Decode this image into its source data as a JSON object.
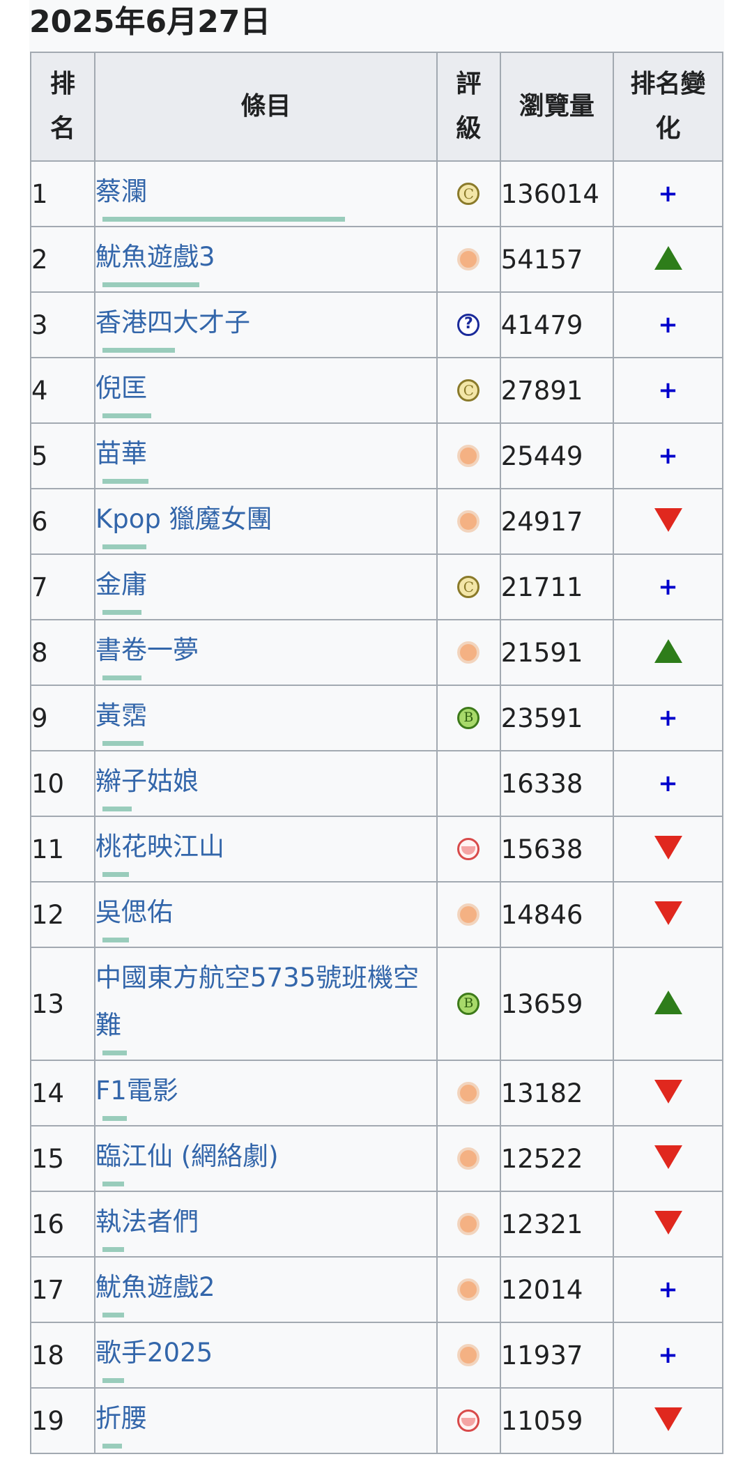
{
  "date": "2025年6月27日",
  "headers": {
    "rank": "排\n名",
    "title": "條目",
    "rating": "評\n級",
    "views": "瀏覽量",
    "change": "排名變\n化"
  },
  "rows": [
    {
      "rank": "1",
      "title": "蔡瀾",
      "rating": "C",
      "views": "136014",
      "change": "new",
      "bar": 1.0
    },
    {
      "rank": "2",
      "title": "魷魚遊戲3",
      "rating": "start",
      "views": "54157",
      "change": "up",
      "bar": 0.4
    },
    {
      "rank": "3",
      "title": "香港四大才子",
      "rating": "unassessed",
      "views": "41479",
      "change": "new",
      "bar": 0.3
    },
    {
      "rank": "4",
      "title": "倪匡",
      "rating": "C",
      "views": "27891",
      "change": "new",
      "bar": 0.2
    },
    {
      "rank": "5",
      "title": "苗華",
      "rating": "start",
      "views": "25449",
      "change": "new",
      "bar": 0.19
    },
    {
      "rank": "6",
      "title": "Kpop 獵魔女團",
      "rating": "start",
      "views": "24917",
      "change": "down",
      "bar": 0.18
    },
    {
      "rank": "7",
      "title": "金庸",
      "rating": "C",
      "views": "21711",
      "change": "new",
      "bar": 0.16
    },
    {
      "rank": "8",
      "title": "書卷一夢",
      "rating": "start",
      "views": "21591",
      "change": "up",
      "bar": 0.16
    },
    {
      "rank": "9",
      "title": "黃霑",
      "rating": "B",
      "views": "23591",
      "change": "new",
      "bar": 0.17
    },
    {
      "rank": "10",
      "title": "辮子姑娘",
      "rating": "",
      "views": "16338",
      "change": "new",
      "bar": 0.12
    },
    {
      "rank": "11",
      "title": "桃花映江山",
      "rating": "stub",
      "views": "15638",
      "change": "down",
      "bar": 0.11
    },
    {
      "rank": "12",
      "title": "吳偲佑",
      "rating": "start",
      "views": "14846",
      "change": "down",
      "bar": 0.11
    },
    {
      "rank": "13",
      "title": "中國東方航空5735號班機空難",
      "rating": "B",
      "views": "13659",
      "change": "up",
      "bar": 0.1
    },
    {
      "rank": "14",
      "title": "F1電影",
      "rating": "start",
      "views": "13182",
      "change": "down",
      "bar": 0.1
    },
    {
      "rank": "15",
      "title": "臨江仙 (網絡劇)",
      "rating": "start",
      "views": "12522",
      "change": "down",
      "bar": 0.09
    },
    {
      "rank": "16",
      "title": "執法者們",
      "rating": "start",
      "views": "12321",
      "change": "down",
      "bar": 0.09
    },
    {
      "rank": "17",
      "title": "魷魚遊戲2",
      "rating": "start",
      "views": "12014",
      "change": "new",
      "bar": 0.09
    },
    {
      "rank": "18",
      "title": "歌手2025",
      "rating": "start",
      "views": "11937",
      "change": "new",
      "bar": 0.09
    },
    {
      "rank": "19",
      "title": "折腰",
      "rating": "stub",
      "views": "11059",
      "change": "down",
      "bar": 0.08
    }
  ],
  "symbols": {
    "new": "+"
  }
}
